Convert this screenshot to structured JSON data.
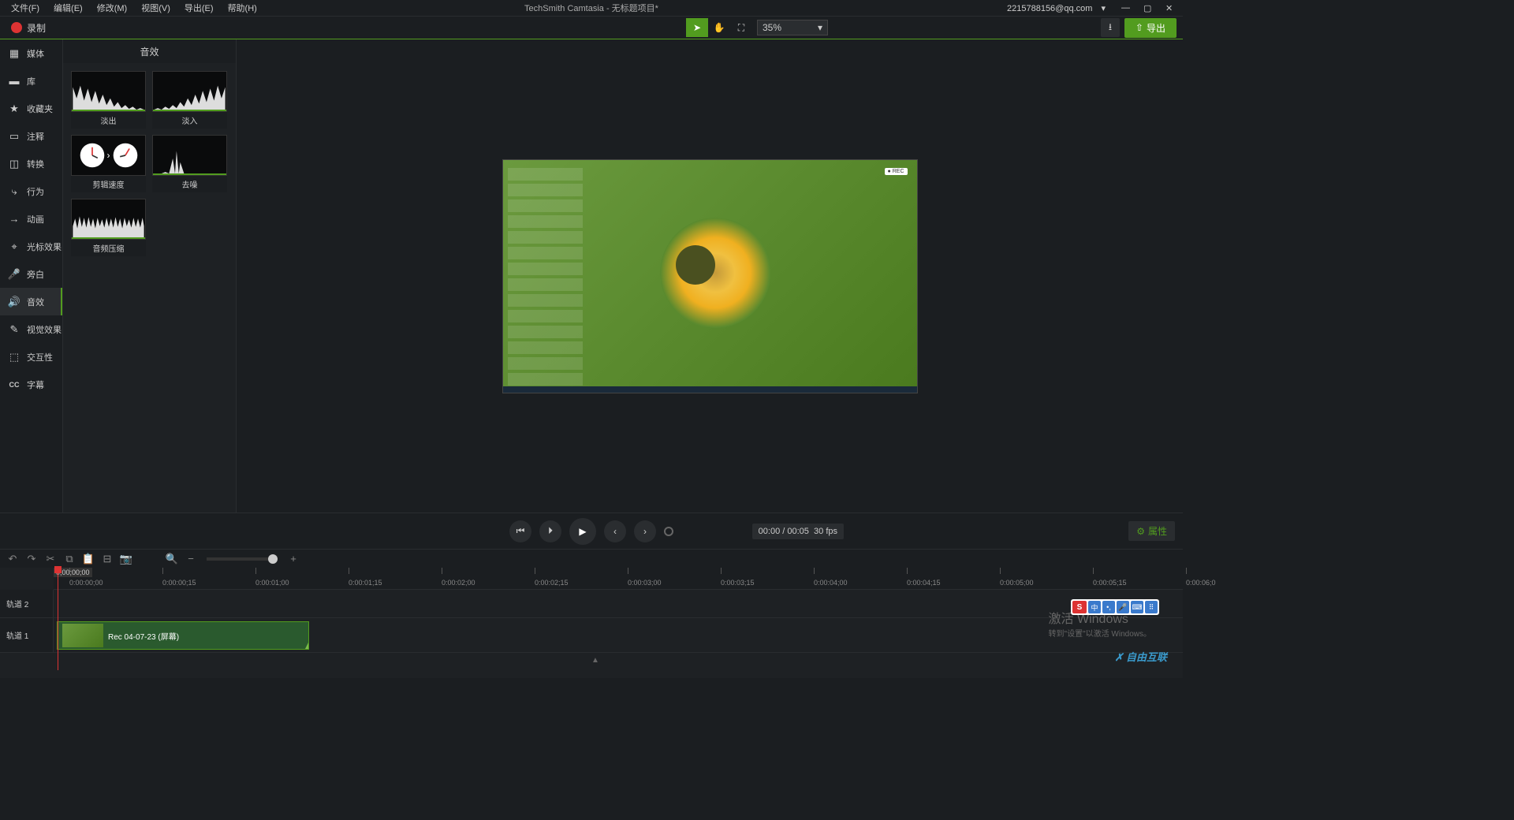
{
  "app_title": "TechSmith Camtasia - 无标题项目*",
  "account": "2215788156@qq.com",
  "menu": {
    "file": "文件(F)",
    "edit": "编辑(E)",
    "modify": "修改(M)",
    "view": "视图(V)",
    "export": "导出(E)",
    "help": "帮助(H)"
  },
  "record_label": "录制",
  "zoom_level": "35%",
  "export_btn": "导出",
  "sidebar": {
    "media": "媒体",
    "library": "库",
    "favorites": "收藏夹",
    "annotations": "注释",
    "transitions": "转换",
    "behaviors": "行为",
    "animations": "动画",
    "cursor": "光标效果",
    "narration": "旁白",
    "audio": "音效",
    "visual": "视觉效果",
    "interactive": "交互性",
    "captions": "字幕"
  },
  "assets_panel_title": "音效",
  "assets": {
    "fadeout": "淡出",
    "fadein": "淡入",
    "clipspeed": "剪辑速度",
    "denoise": "去噪",
    "compress": "音频压缩"
  },
  "playback": {
    "time": "00:00 / 00:05",
    "fps": "30 fps",
    "properties": "属性"
  },
  "timeline": {
    "playhead": "0;00;00;00",
    "ticks": [
      "0:00:00;00",
      "0:00:00;15",
      "0:00:01;00",
      "0:00:01;15",
      "0:00:02;00",
      "0:00:02;15",
      "0:00:03;00",
      "0:00:03;15",
      "0:00:04;00",
      "0:00:04;15",
      "0:00:05;00",
      "0:00:05;15",
      "0:00:06;0"
    ],
    "track2": "轨道 2",
    "track1": "轨道 1",
    "clip_name": "Rec 04-07-23 (屏幕)"
  },
  "watermark": {
    "title": "激活 Windows",
    "sub": "转到\"设置\"以激活 Windows。"
  },
  "ime_zhong": "中",
  "brand": "自由互联"
}
